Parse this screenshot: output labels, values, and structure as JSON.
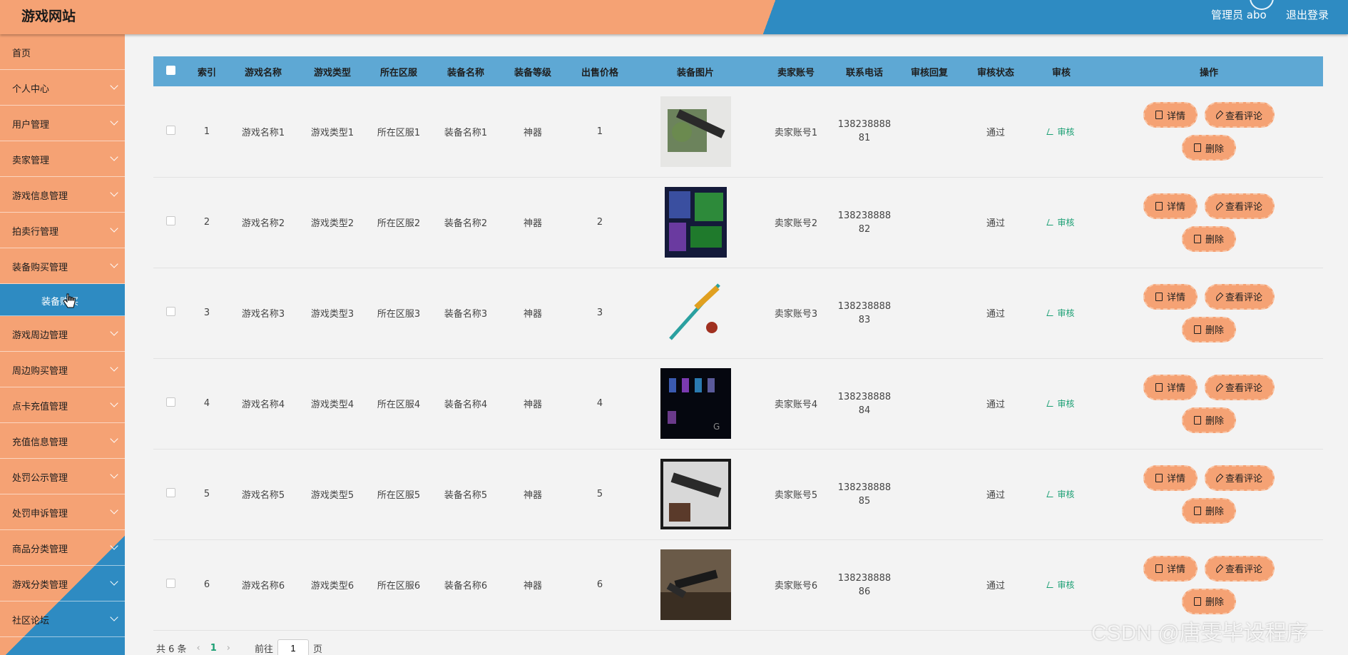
{
  "header": {
    "title": "游戏网站",
    "user": "管理员 abo",
    "logout": "退出登录"
  },
  "sidebar": {
    "items": [
      {
        "label": "首页",
        "chevron": false
      },
      {
        "label": "个人中心",
        "chevron": true
      },
      {
        "label": "用户管理",
        "chevron": true
      },
      {
        "label": "卖家管理",
        "chevron": true
      },
      {
        "label": "游戏信息管理",
        "chevron": true
      },
      {
        "label": "拍卖行管理",
        "chevron": true
      },
      {
        "label": "装备购买管理",
        "chevron": true
      }
    ],
    "submenu": {
      "label": "装备购买"
    },
    "items_after": [
      {
        "label": "游戏周边管理",
        "chevron": true
      },
      {
        "label": "周边购买管理",
        "chevron": true
      },
      {
        "label": "点卡充值管理",
        "chevron": true
      },
      {
        "label": "充值信息管理",
        "chevron": true
      },
      {
        "label": "处罚公示管理",
        "chevron": true
      },
      {
        "label": "处罚申诉管理",
        "chevron": true
      },
      {
        "label": "商品分类管理",
        "chevron": true
      },
      {
        "label": "游戏分类管理",
        "chevron": true
      },
      {
        "label": "社区论坛",
        "chevron": true
      }
    ]
  },
  "table": {
    "columns": [
      "索引",
      "游戏名称",
      "游戏类型",
      "所在区服",
      "装备名称",
      "装备等级",
      "出售价格",
      "装备图片",
      "卖家账号",
      "联系电话",
      "审核回复",
      "审核状态",
      "审核",
      "操作"
    ],
    "rows": [
      {
        "index": "1",
        "game": "游戏名称1",
        "type": "游戏类型1",
        "server": "所在区服1",
        "equip": "装备名称1",
        "level": "神器",
        "price": "1",
        "image": "rifle-camo",
        "seller": "卖家账号1",
        "phone1": "138238888",
        "phone2": "81",
        "reply": "",
        "status": "通过",
        "audit": "审核"
      },
      {
        "index": "2",
        "game": "游戏名称2",
        "type": "游戏类型2",
        "server": "所在区服2",
        "equip": "装备名称2",
        "level": "神器",
        "price": "2",
        "image": "game-screen",
        "seller": "卖家账号2",
        "phone1": "138238888",
        "phone2": "82",
        "reply": "",
        "status": "通过",
        "audit": "审核"
      },
      {
        "index": "3",
        "game": "游戏名称3",
        "type": "游戏类型3",
        "server": "所在区服3",
        "equip": "装备名称3",
        "level": "神器",
        "price": "3",
        "image": "sword",
        "seller": "卖家账号3",
        "phone1": "138238888",
        "phone2": "83",
        "reply": "",
        "status": "通过",
        "audit": "审核"
      },
      {
        "index": "4",
        "game": "游戏名称4",
        "type": "游戏类型4",
        "server": "所在区服4",
        "equip": "装备名称4",
        "level": "神器",
        "price": "4",
        "image": "dark-inventory",
        "seller": "卖家账号4",
        "phone1": "138238888",
        "phone2": "84",
        "reply": "",
        "status": "通过",
        "audit": "审核"
      },
      {
        "index": "5",
        "game": "游戏名称5",
        "type": "游戏类型5",
        "server": "所在区服5",
        "equip": "装备名称5",
        "level": "神器",
        "price": "5",
        "image": "rifle-pattern",
        "seller": "卖家账号5",
        "phone1": "138238888",
        "phone2": "85",
        "reply": "",
        "status": "通过",
        "audit": "审核"
      },
      {
        "index": "6",
        "game": "游戏名称6",
        "type": "游戏类型6",
        "server": "所在区服6",
        "equip": "装备名称6",
        "level": "神器",
        "price": "6",
        "image": "gun-wood",
        "seller": "卖家账号6",
        "phone1": "138238888",
        "phone2": "86",
        "reply": "",
        "status": "通过",
        "audit": "审核"
      }
    ],
    "actions": {
      "detail": "详情",
      "comments": "查看评论",
      "delete": "删除"
    }
  },
  "pager": {
    "total": "共 6 条",
    "prev": "‹",
    "current": "1",
    "next": "›",
    "goto_label": "前往",
    "goto_value": "1",
    "page_suffix": "页"
  },
  "watermark": "CSDN @唐雯毕设程序",
  "colors": {
    "accent": "#f5a274",
    "blue": "#2e8bc2",
    "header_row": "#5ea8d4",
    "audit_green": "#1a9f73"
  }
}
